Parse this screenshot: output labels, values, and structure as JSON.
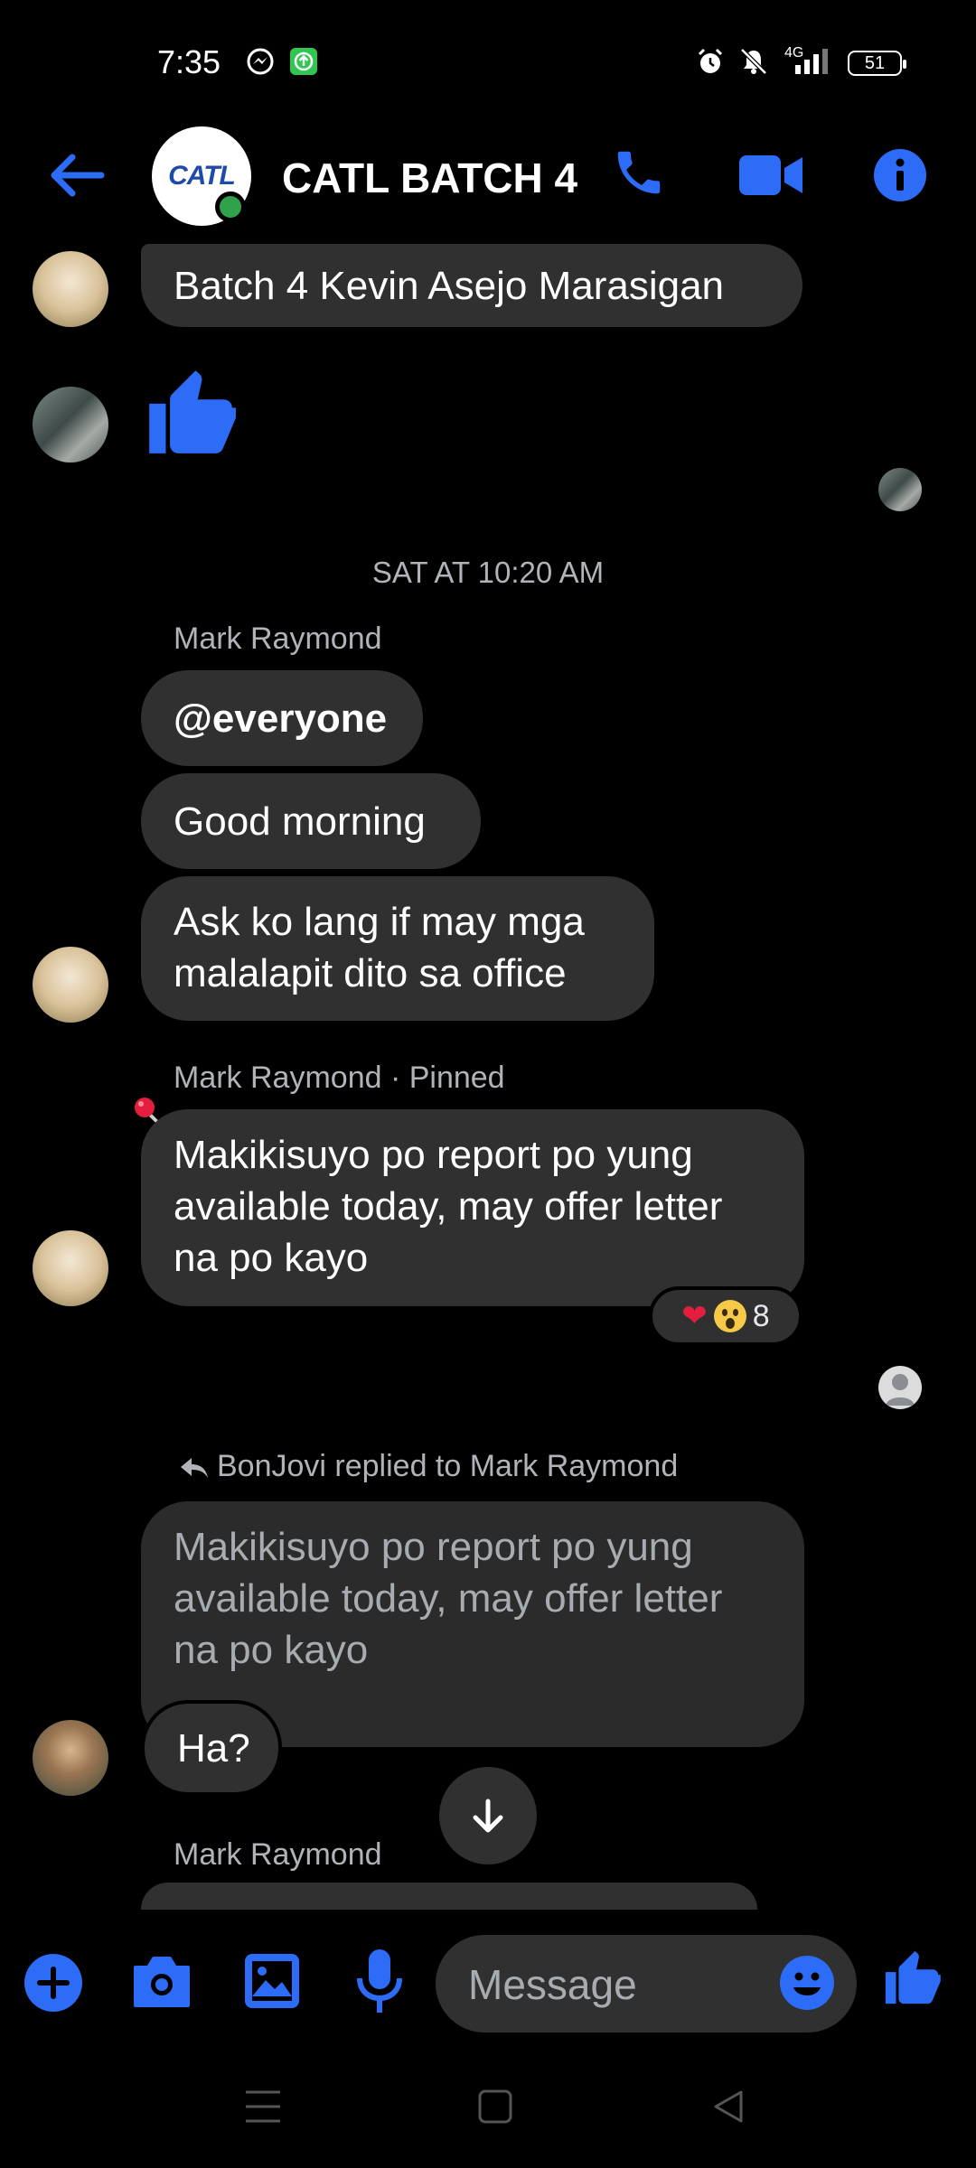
{
  "status_bar": {
    "time": "7:35",
    "network": "4G",
    "battery": "51",
    "icons": [
      "messenger-icon",
      "upload-icon",
      "alarm-icon",
      "mute-icon",
      "signal-icon",
      "battery-icon"
    ]
  },
  "header": {
    "title": "CATL BATCH 4",
    "avatar_text": "CATL",
    "icons": [
      "back-arrow-icon",
      "phone-icon",
      "video-icon",
      "info-icon"
    ]
  },
  "messages": {
    "m1": {
      "text": "Batch 4 Kevin Asejo Marasigan"
    },
    "date": "SAT AT 10:20 AM",
    "group1": {
      "sender": "Mark Raymond",
      "bubble1": "@everyone",
      "bubble2": "Good morning",
      "bubble3": {
        "line1": "Ask ko lang if may mga",
        "line2": "malalapit dito sa office"
      }
    },
    "pinned": {
      "sender": "Mark Raymond · Pinned",
      "line1": "Makikisuyo po report po yung",
      "line2": "available today, may offer letter",
      "line3": "na po kayo",
      "reaction_count": "8"
    },
    "reply": {
      "context": "BonJovi replied to Mark Raymond",
      "quote": {
        "line1": "Makikisuyo po report po yung",
        "line2": "available today, may offer letter",
        "line3": "na po kayo"
      },
      "text": "Ha?"
    },
    "next_sender": "Mark Raymond"
  },
  "composer": {
    "placeholder": "Message"
  },
  "colors": {
    "accent": "#2d6cf6",
    "bubble": "#303030",
    "secondary_text": "#b0b3b8"
  }
}
